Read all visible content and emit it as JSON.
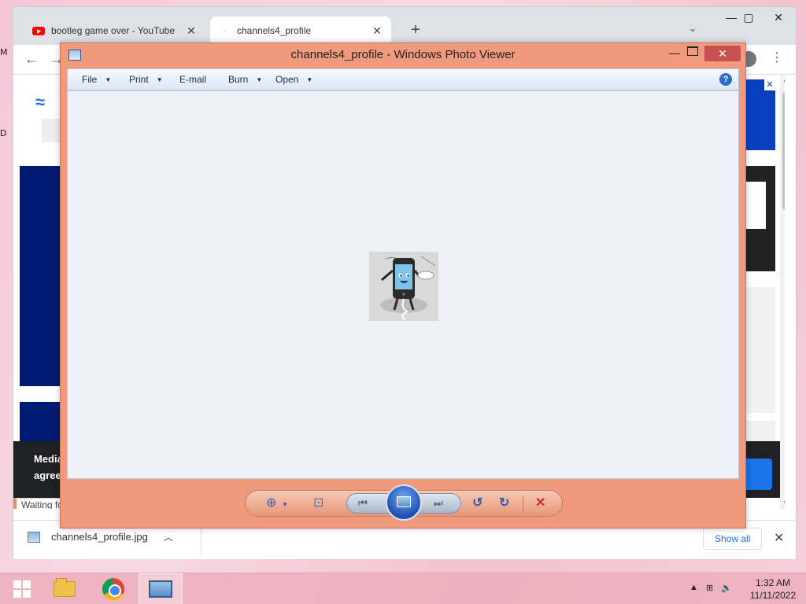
{
  "desktop": {
    "glyph_top": "M",
    "glyph_mid": "D"
  },
  "browser": {
    "tabs": [
      {
        "label": "bootleg game over - YouTube",
        "favicon": "youtube-icon"
      },
      {
        "label": "channels4_profile",
        "favicon": "loading-icon"
      }
    ],
    "new_tab": "+",
    "tab_search": "⌄",
    "window_controls": {
      "minimize": "—",
      "maximize": "▢",
      "close": "✕"
    },
    "status_text": "Waiting fo",
    "page": {
      "cookie_line1": "Media",
      "cookie_line2": "agree"
    },
    "downloads": {
      "file_name": "channels4_profile.jpg",
      "show_all": "Show all",
      "close": "✕"
    }
  },
  "photo_viewer": {
    "title": "channels4_profile - Windows Photo Viewer",
    "menu": [
      "File",
      "Print",
      "E-mail",
      "Burn",
      "Open"
    ],
    "help": "?",
    "close": "✕",
    "controls": {
      "zoom": "⊕",
      "actual_size": "⊡",
      "previous": "⏮",
      "next": "⏭",
      "rotate_ccw": "↺",
      "rotate_cw": "↻",
      "delete": "✕"
    }
  },
  "taskbar": {
    "time": "1:32 AM",
    "date": "11/11/2022",
    "tray": [
      "▲",
      "⊞",
      "🔈"
    ]
  },
  "colors": {
    "viewer_frame": "#ef9a7c",
    "viewer_canvas": "#eef0f8",
    "taskbar": "#ecaeba",
    "link": "#1a73e8"
  }
}
